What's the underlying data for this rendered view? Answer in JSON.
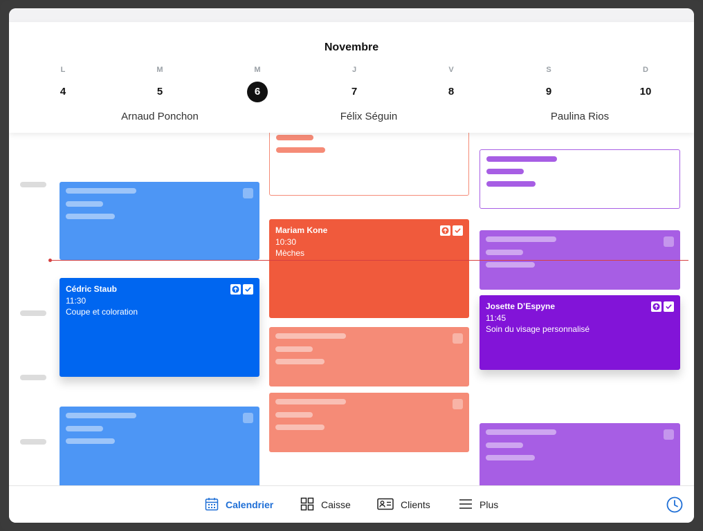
{
  "header": {
    "month": "Novembre",
    "days": [
      {
        "letter": "L",
        "num": "4"
      },
      {
        "letter": "M",
        "num": "5"
      },
      {
        "letter": "M",
        "num": "6"
      },
      {
        "letter": "J",
        "num": "7"
      },
      {
        "letter": "V",
        "num": "8"
      },
      {
        "letter": "S",
        "num": "9"
      },
      {
        "letter": "D",
        "num": "10"
      }
    ],
    "selected_day": "6",
    "staff": [
      "Arnaud Ponchon",
      "Félix Séguin",
      "Paulina Rios"
    ]
  },
  "appointments": {
    "cedric": {
      "name": "Cédric Staub",
      "time": "11:30",
      "service": "Coupe et coloration"
    },
    "mariam": {
      "name": "Mariam Kone",
      "time": "10:30",
      "service": "Mèches"
    },
    "josette": {
      "name": "Josette D’Espyne",
      "time": "11:45",
      "service": "Soin du visage personnalisé"
    }
  },
  "colors": {
    "blue": "#0066f0",
    "blue_light": "#4d96f5",
    "orange": "#f05a3c",
    "orange_light": "#f58b77",
    "purple": "#8214d8",
    "purple_light": "#a75ee4",
    "accent": "#1f6fd6"
  },
  "tabbar": {
    "calendar": "Calendrier",
    "register": "Caisse",
    "clients": "Clients",
    "more": "Plus"
  }
}
